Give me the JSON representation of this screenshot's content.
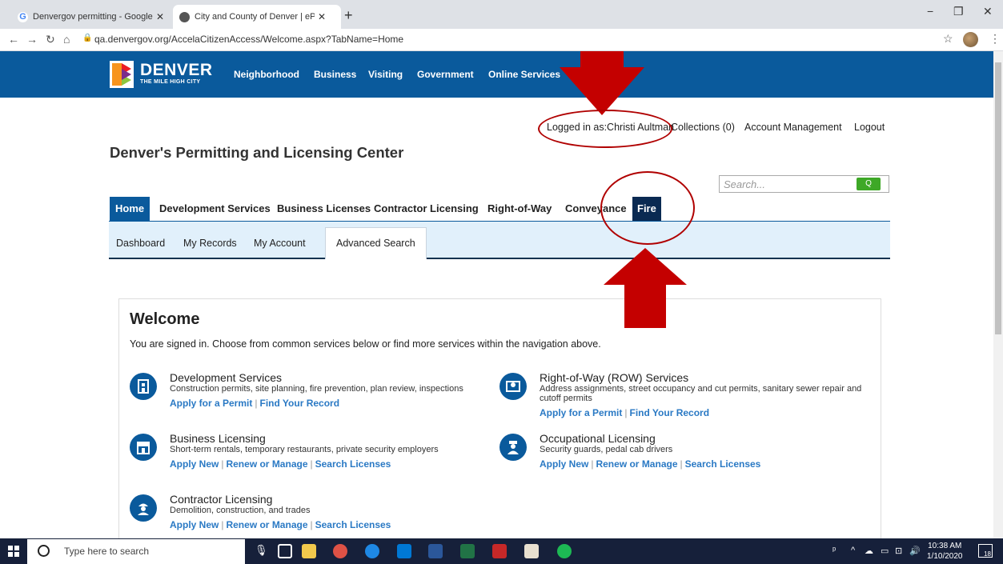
{
  "browser": {
    "tabs": [
      {
        "label": "Denvergov permitting - Google S",
        "active": false
      },
      {
        "label": "City and County of Denver | ePer",
        "active": true
      }
    ],
    "url": "qa.denvergov.org/AccelaCitizenAccess/Welcome.aspx?TabName=Home"
  },
  "site": {
    "logo_text": "DENVER",
    "logo_sub": "THE MILE HIGH CITY",
    "nav": [
      "Neighborhood",
      "Business",
      "Visiting",
      "Government",
      "Online Services"
    ]
  },
  "user": {
    "logged_in": "Logged in as:Christi Aultman",
    "collections": "Collections (0)",
    "account": "Account Management",
    "logout": "Logout"
  },
  "page_title": "Denver's Permitting and Licensing Center",
  "search": {
    "placeholder": "Search...",
    "button": "Q"
  },
  "main_tabs": [
    "Home",
    "Development Services",
    "Business Licenses",
    "Contractor Licensing",
    "Right-of-Way",
    "Conveyance",
    "Fire"
  ],
  "sub_tabs": [
    "Dashboard",
    "My Records",
    "My Account",
    "Advanced Search"
  ],
  "welcome": {
    "title": "Welcome",
    "intro": "You are signed in. Choose from common services below or find more services within the navigation above.",
    "services": [
      {
        "title": "Development Services",
        "desc": "Construction permits, site planning, fire prevention, plan review, inspections",
        "links": [
          "Apply for a Permit",
          "Find Your Record"
        ],
        "icon": "building-icon"
      },
      {
        "title": "Right-of-Way (ROW) Services",
        "desc": "Address assignments, street occupancy and cut permits, sanitary sewer repair and cutoff permits",
        "links": [
          "Apply for a Permit",
          "Find Your Record"
        ],
        "icon": "map-icon"
      },
      {
        "title": "Business Licensing",
        "desc": "Short-term rentals, temporary restaurants, private security employers",
        "links": [
          "Apply New",
          "Renew or Manage",
          "Search Licenses"
        ],
        "icon": "storefront-icon"
      },
      {
        "title": "Occupational Licensing",
        "desc": "Security guards, pedal cab drivers",
        "links": [
          "Apply New",
          "Renew or Manage",
          "Search Licenses"
        ],
        "icon": "officer-icon"
      },
      {
        "title": "Contractor Licensing",
        "desc": "Demolition, construction, and trades",
        "links": [
          "Apply New",
          "Renew or Manage",
          "Search Licenses"
        ],
        "icon": "worker-icon"
      }
    ]
  },
  "taskbar": {
    "search_placeholder": "Type here to search",
    "time": "10:38 AM",
    "date": "1/10/2020",
    "notifications": "18"
  },
  "colors": {
    "brand_blue": "#0a5a9c",
    "fire_tab": "#0a2a52",
    "link_blue": "#2a79c4",
    "annotation_red": "#b00000"
  }
}
